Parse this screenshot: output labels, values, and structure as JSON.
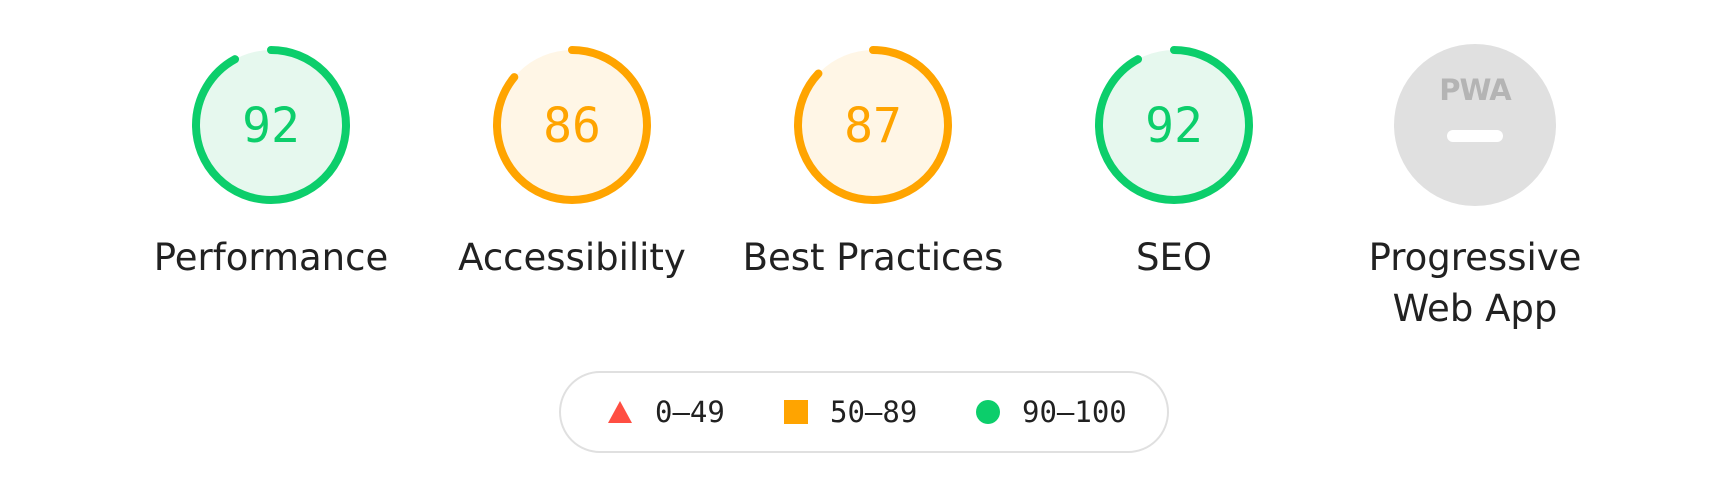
{
  "colors": {
    "pass": "#0cce6b",
    "pass_bg": "#e6f8ee",
    "average": "#ffa400",
    "average_bg": "#fff6e6",
    "fail": "#ff4e42",
    "na_bg": "#e0e0e0",
    "na_fg": "#b4b4b4",
    "text": "#212121"
  },
  "categories": [
    {
      "label": "Performance",
      "score": "92",
      "percent": 92,
      "rating": "pass"
    },
    {
      "label": "Accessibility",
      "score": "86",
      "percent": 86,
      "rating": "average"
    },
    {
      "label": "Best Practices",
      "score": "87",
      "percent": 87,
      "rating": "average"
    },
    {
      "label": "SEO",
      "score": "92",
      "percent": 92,
      "rating": "pass"
    },
    {
      "label_line1": "Progressive",
      "label_line2": "Web App",
      "badge": "PWA",
      "rating": "not-applicable"
    }
  ],
  "legend": {
    "fail_range": "0–49",
    "average_range": "50–89",
    "pass_range": "90–100"
  }
}
